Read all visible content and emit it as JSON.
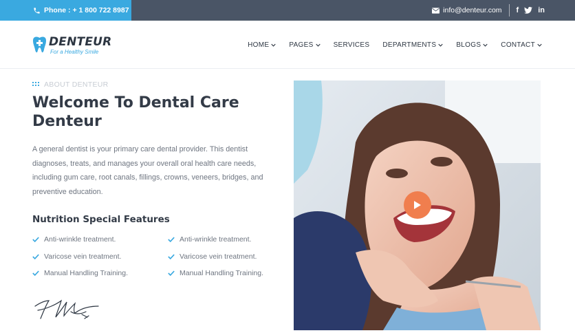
{
  "topbar": {
    "phone_label": "Phone :",
    "phone_number": "+ 1 800 722 8987",
    "email": "info@denteur.com",
    "social": [
      "f",
      "twitter-icon",
      "in"
    ]
  },
  "brand": {
    "name": "DENTEUR",
    "tagline": "For a Healthy Smile"
  },
  "nav": {
    "items": [
      {
        "label": "HOME",
        "dropdown": true
      },
      {
        "label": "PAGES",
        "dropdown": true
      },
      {
        "label": "SERVICES",
        "dropdown": false
      },
      {
        "label": "DEPARTMENTS",
        "dropdown": true
      },
      {
        "label": "BLOGS",
        "dropdown": true
      },
      {
        "label": "CONTACT",
        "dropdown": true
      }
    ]
  },
  "about": {
    "eyebrow": "ABOUT DENTEUR",
    "title": "Welcome To Dental Care Denteur",
    "paragraph": "A general dentist is your primary care dental provider. This dentist diagnoses, treats, and manages your overall oral health care needs, including gum care, root canals, fillings, crowns, veneers, bridges, and preventive education.",
    "features_title": "Nutrition Special Features",
    "features": [
      "Anti-wrinkle treatment.",
      "Anti-wrinkle treatment.",
      "Varicose vein treatment.",
      "Varicose vein treatment.",
      "Manual Handling Training.",
      "Manual Handling Training."
    ]
  },
  "colors": {
    "accent": "#3aa9e0",
    "topbar": "#4a5566",
    "play": "#f07e4e",
    "heading": "#333b47"
  },
  "media": {
    "play_icon": "play-icon"
  }
}
